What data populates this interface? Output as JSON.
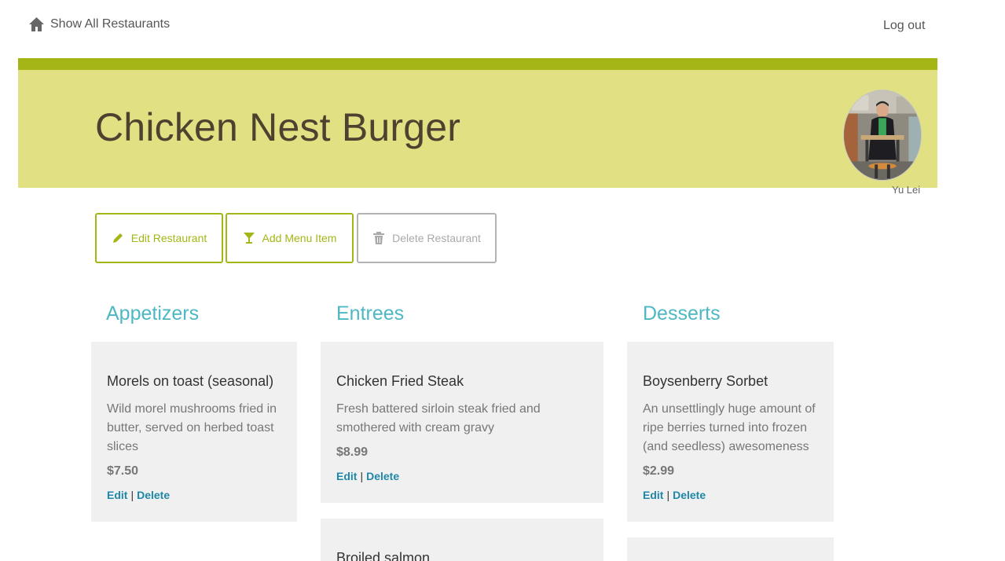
{
  "nav": {
    "home_icon": "home-icon",
    "home_label": "Show All Restaurants",
    "logout_label": "Log out"
  },
  "restaurant": {
    "name": "Chicken Nest Burger"
  },
  "user": {
    "name": "Yu Lei"
  },
  "actions": {
    "edit": {
      "label": "Edit Restaurant",
      "icon": "pencil-icon"
    },
    "add": {
      "label": "Add Menu Item",
      "icon": "cocktail-glass-icon"
    },
    "delete": {
      "label": "Delete Restaurant",
      "icon": "trash-icon"
    }
  },
  "columns": [
    {
      "heading": "Appetizers",
      "items": [
        {
          "name": "Morels on toast (seasonal)",
          "description": "Wild morel mushrooms fried in butter, served on herbed toast slices",
          "price": "$7.50",
          "edit": "Edit",
          "delete": "Delete"
        }
      ]
    },
    {
      "heading": "Entrees",
      "items": [
        {
          "name": "Chicken Fried Steak",
          "description": "Fresh battered sirloin steak fried and smothered with cream gravy",
          "price": "$8.99",
          "edit": "Edit",
          "delete": "Delete"
        },
        {
          "name": "Broiled salmon"
        }
      ]
    },
    {
      "heading": "Desserts",
      "items": [
        {
          "name": "Boysenberry Sorbet",
          "description": "An unsettlingly huge amount of ripe berries turned into frozen (and seedless) awesomeness",
          "price": "$2.99",
          "edit": "Edit",
          "delete": "Delete"
        }
      ]
    }
  ],
  "link_separator": "|",
  "colors": {
    "accent": "#a3b615",
    "banner": "#e1e184",
    "heading": "#4db8c4",
    "link": "#1f87a8",
    "card": "#f0f0f0"
  }
}
